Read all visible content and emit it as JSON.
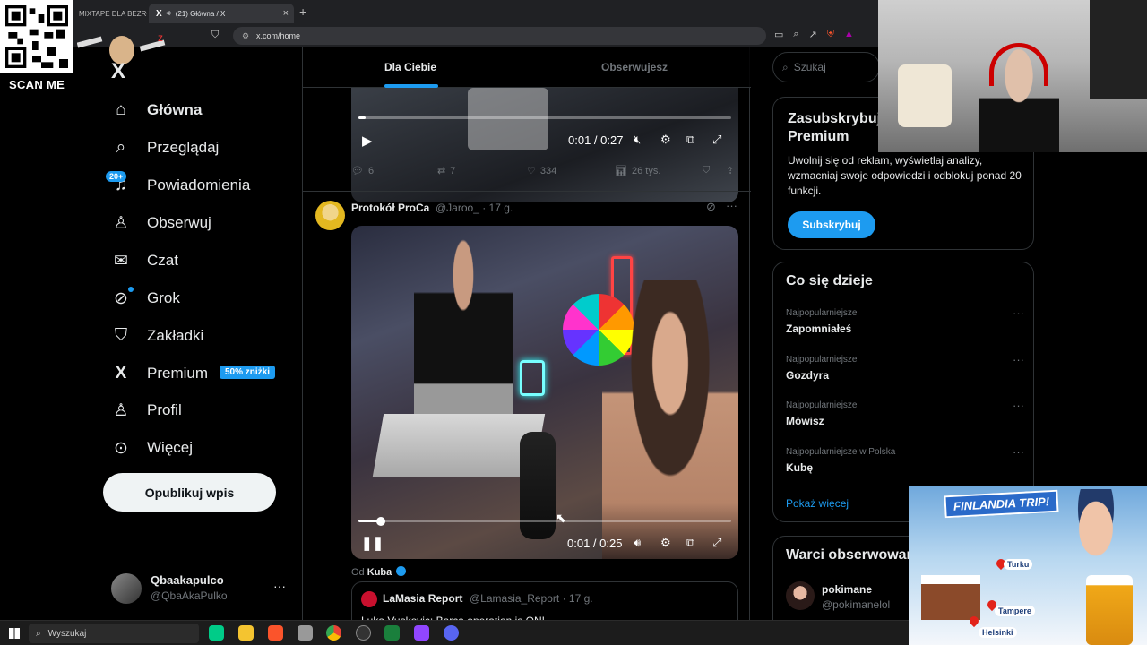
{
  "browser": {
    "inactive_tab": "MIXTAPE DLA BEZRO",
    "active_tab": "(21) Główna / X",
    "active_tab_logo": "X",
    "tab_close": "×",
    "new_tab": "+",
    "url": "x.com/home"
  },
  "overlay": {
    "scan_me": "SCAN ME"
  },
  "sidebar": {
    "logo": "X",
    "items": [
      {
        "label": "Główna",
        "icon": "home-icon",
        "glyph": "⌂"
      },
      {
        "label": "Przeglądaj",
        "icon": "search-icon",
        "glyph": "⌕"
      },
      {
        "label": "Powiadomienia",
        "icon": "bell-icon",
        "glyph": "🔔︎"
      },
      {
        "label": "Obserwuj",
        "icon": "person-add-icon",
        "glyph": "⚇"
      },
      {
        "label": "Czat",
        "icon": "mail-icon",
        "glyph": "✉"
      },
      {
        "label": "Grok",
        "icon": "grok-icon",
        "glyph": "⊘"
      },
      {
        "label": "Zakładki",
        "icon": "bookmark-icon",
        "glyph": "⛉"
      },
      {
        "label": "Premium",
        "icon": "x-premium-icon",
        "glyph": "X"
      },
      {
        "label": "Profil",
        "icon": "profile-icon",
        "glyph": "♙"
      },
      {
        "label": "Więcej",
        "icon": "more-icon",
        "glyph": "⋯"
      }
    ],
    "notif_badge": "20+",
    "premium_badge": "50% zniżki",
    "post_button": "Opublikuj wpis",
    "profile_name": "Qbaakapulco",
    "profile_handle": "@QbaAkaPulko",
    "profile_more": "···"
  },
  "feed": {
    "tab_for_you": "Dla Ciebie",
    "tab_following": "Obserwujesz",
    "tweet1": {
      "video_time": "0:01 / 0:27",
      "video_progress": 0.02,
      "replies": "6",
      "reposts": "7",
      "likes": "334",
      "views": "26 tys."
    },
    "tweet2": {
      "name": "Protokół ProCa",
      "handle": "@Jaroo_ · 17 g.",
      "more": "···",
      "video_time": "0:01 / 0:25",
      "video_progress": 0.06,
      "from_label": "Od",
      "from_name": "Kuba",
      "quote_name": "LaMasia Report",
      "quote_handle": "@Lamasia_Report · 17 g.",
      "quote_text": "Luka Vuskovic: Barca operation is ON!"
    }
  },
  "right": {
    "search_placeholder": "Szukaj",
    "premium_title": "Zasubskrybuj Premium",
    "premium_desc": "Uwolnij się od reklam, wyświetlaj analizy, wzmacniaj swoje odpowiedzi i odblokuj ponad 20 funkcji.",
    "subscribe_button": "Subskrybuj",
    "trends_title": "Co się dzieje",
    "trends": [
      {
        "category": "Najpopularniejsze",
        "name": "Zapomniałeś"
      },
      {
        "category": "Najpopularniejsze",
        "name": "Gozdyra"
      },
      {
        "category": "Najpopularniejsze",
        "name": "Mówisz"
      },
      {
        "category": "Najpopularniejsze w Polska",
        "name": "Kubę"
      }
    ],
    "trend_more": "···",
    "show_more": "Pokaż więcej",
    "follow_title": "Warci obserwowania",
    "follow_name": "pokimane",
    "follow_handle": "@pokimanelol"
  },
  "promo": {
    "banner": "FINLANDIA TRIP!",
    "cities": [
      "Turku",
      "Tampere",
      "Helsinki"
    ]
  },
  "taskbar": {
    "search": "Wyszukaj"
  },
  "colors": {
    "accent": "#1d9bf0",
    "bg": "#000000",
    "muted": "#71767b",
    "border": "#2f3336"
  }
}
